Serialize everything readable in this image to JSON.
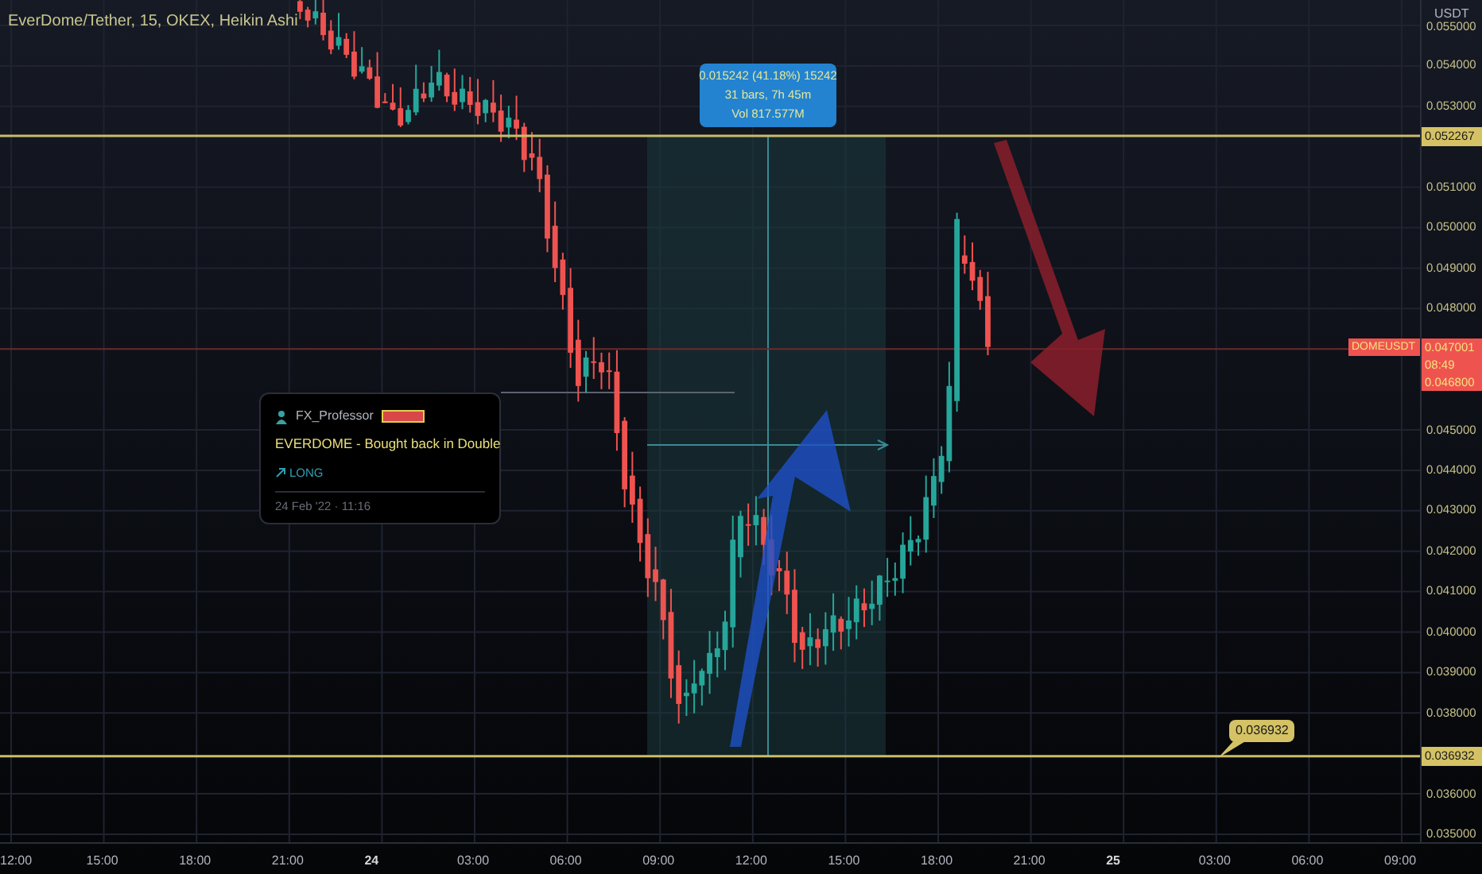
{
  "chart": {
    "title": "EverDome/Tether, 15, OKEX, Heikin Ashi"
  },
  "price_axis": {
    "unit": "USDT",
    "labels": [
      "0.055000",
      "0.054000",
      "0.053000",
      "0.051000",
      "0.050000",
      "0.049000",
      "0.048000",
      "0.045000",
      "0.044000",
      "0.043000",
      "0.042000",
      "0.041000",
      "0.040000",
      "0.039000",
      "0.038000",
      "0.036000",
      "0.035000"
    ]
  },
  "time_axis": {
    "labels": [
      {
        "text": "12:00",
        "kind": "time"
      },
      {
        "text": "15:00",
        "kind": "time"
      },
      {
        "text": "18:00",
        "kind": "time"
      },
      {
        "text": "21:00",
        "kind": "time"
      },
      {
        "text": "24",
        "kind": "day"
      },
      {
        "text": "03:00",
        "kind": "time"
      },
      {
        "text": "06:00",
        "kind": "time"
      },
      {
        "text": "09:00",
        "kind": "time"
      },
      {
        "text": "12:00",
        "kind": "time"
      },
      {
        "text": "15:00",
        "kind": "time"
      },
      {
        "text": "18:00",
        "kind": "time"
      },
      {
        "text": "21:00",
        "kind": "time"
      },
      {
        "text": "25",
        "kind": "day"
      },
      {
        "text": "03:00",
        "kind": "time"
      },
      {
        "text": "06:00",
        "kind": "time"
      },
      {
        "text": "09:00",
        "kind": "time"
      }
    ]
  },
  "level_tags": [
    "0.052267",
    "0.036932"
  ],
  "measure_tooltip": {
    "lines": [
      "0.015242 (41.18%) 15242",
      "31 bars, 7h 45m",
      "Vol 817.577M"
    ]
  },
  "idea_card": {
    "author": "FX_Professor",
    "title": "EVERDOME - Bought back in Double",
    "direction": "LONG",
    "date": "24 Feb '22 · 11:16"
  },
  "callout": {
    "text": "0.036932"
  },
  "symbol_tag": {
    "symbol": "DOMEUSDT",
    "price": "0.047001",
    "countdown": "08:49",
    "low": "0.046800"
  }
}
